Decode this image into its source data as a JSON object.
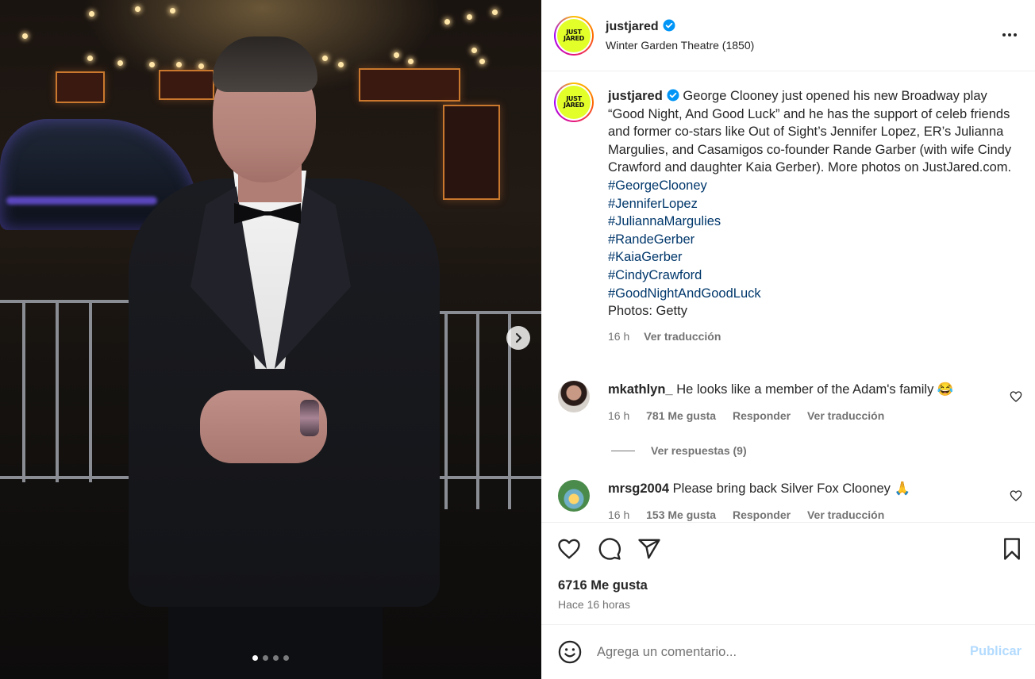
{
  "post": {
    "account": "justjared",
    "avatar_logo_line1": "JUST",
    "avatar_logo_line2": "JARED",
    "location": "Winter Garden Theatre (1850)",
    "caption_text": "George Clooney just opened his new Broadway play “Good Night, And Good Luck” and he has the support of celeb friends and former co-stars like Out of Sight’s Jennifer Lopez, ER’s Julianna Margulies, and Casamigos co-founder Rande Garber (with wife Cindy Crawford and daughter Kaia Gerber). More photos on JustJared.com.",
    "hashtags": [
      "#GeorgeClooney",
      "#JenniferLopez",
      "#JuliannaMargulies",
      "#RandeGerber",
      "#KaiaGerber",
      "#CindyCrawford",
      "#GoodNightAndGoodLuck"
    ],
    "photo_credit": "Photos: Getty",
    "caption_time": "16 h",
    "translate_label": "Ver traducción",
    "carousel": {
      "slides": 4,
      "active": 1
    }
  },
  "comments": [
    {
      "user": "mkathlyn_",
      "text": "He looks like a member of the Adam's family 😂",
      "time": "16 h",
      "likes": "781 Me gusta",
      "reply": "Responder",
      "translate": "Ver traducción",
      "replies_label": "Ver respuestas (9)"
    },
    {
      "user": "mrsg2004",
      "text": "Please bring back Silver Fox Clooney 🙏",
      "time": "16 h",
      "likes": "153 Me gusta",
      "reply": "Responder",
      "translate": "Ver traducción"
    }
  ],
  "stats": {
    "likes": "6716 Me gusta",
    "posted": "Hace 16 horas"
  },
  "compose": {
    "placeholder": "Agrega un comentario...",
    "publish": "Publicar"
  },
  "icons": {
    "verified": "verified-badge-icon",
    "more": "more-options-icon",
    "like": "heart-icon",
    "comment": "comment-bubble-icon",
    "share": "paper-plane-icon",
    "save": "bookmark-icon",
    "emoji": "smiley-icon",
    "next": "chevron-right-icon"
  },
  "colors": {
    "link": "#00376b",
    "verified": "#0095f6",
    "publish_disabled": "#b3dbff",
    "logo_bg": "#e2ff2a"
  }
}
